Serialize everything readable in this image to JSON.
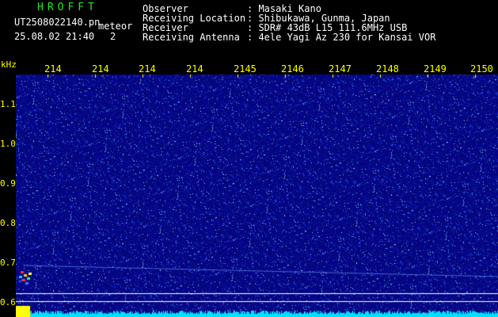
{
  "header": {
    "logo": "HROFFT",
    "filename": "UT2508022140.pn",
    "meteor_label": "meteor",
    "datetime": "25.08.02 21:40",
    "meteor_count": "2",
    "fields": [
      {
        "label": "Observer",
        "value": ": Masaki Kano"
      },
      {
        "label": "Receiving Location",
        "value": ": Shibukawa, Gunma, Japan"
      },
      {
        "label": "Receiver",
        "value": ": SDR# 43dB L15 111.6MHz USB"
      },
      {
        "label": "Receiving Antenna",
        "value": ": 4ele Yagi Az 230 for Kansai VOR"
      }
    ]
  },
  "axes": {
    "y_unit": "kHz",
    "y_ticks": [
      "1.1",
      "1.0",
      "0.9",
      "0.8",
      "0.7",
      "0.6"
    ],
    "x_ticks": [
      "214",
      "214",
      "214",
      "214",
      "2145",
      "2146",
      "2147",
      "2148",
      "2149",
      "2150"
    ]
  },
  "colors": {
    "background": "#000000",
    "text": "#ffffff",
    "axis": "#ffff00",
    "logo": "#22e622",
    "noise": "#0a0a8a"
  }
}
